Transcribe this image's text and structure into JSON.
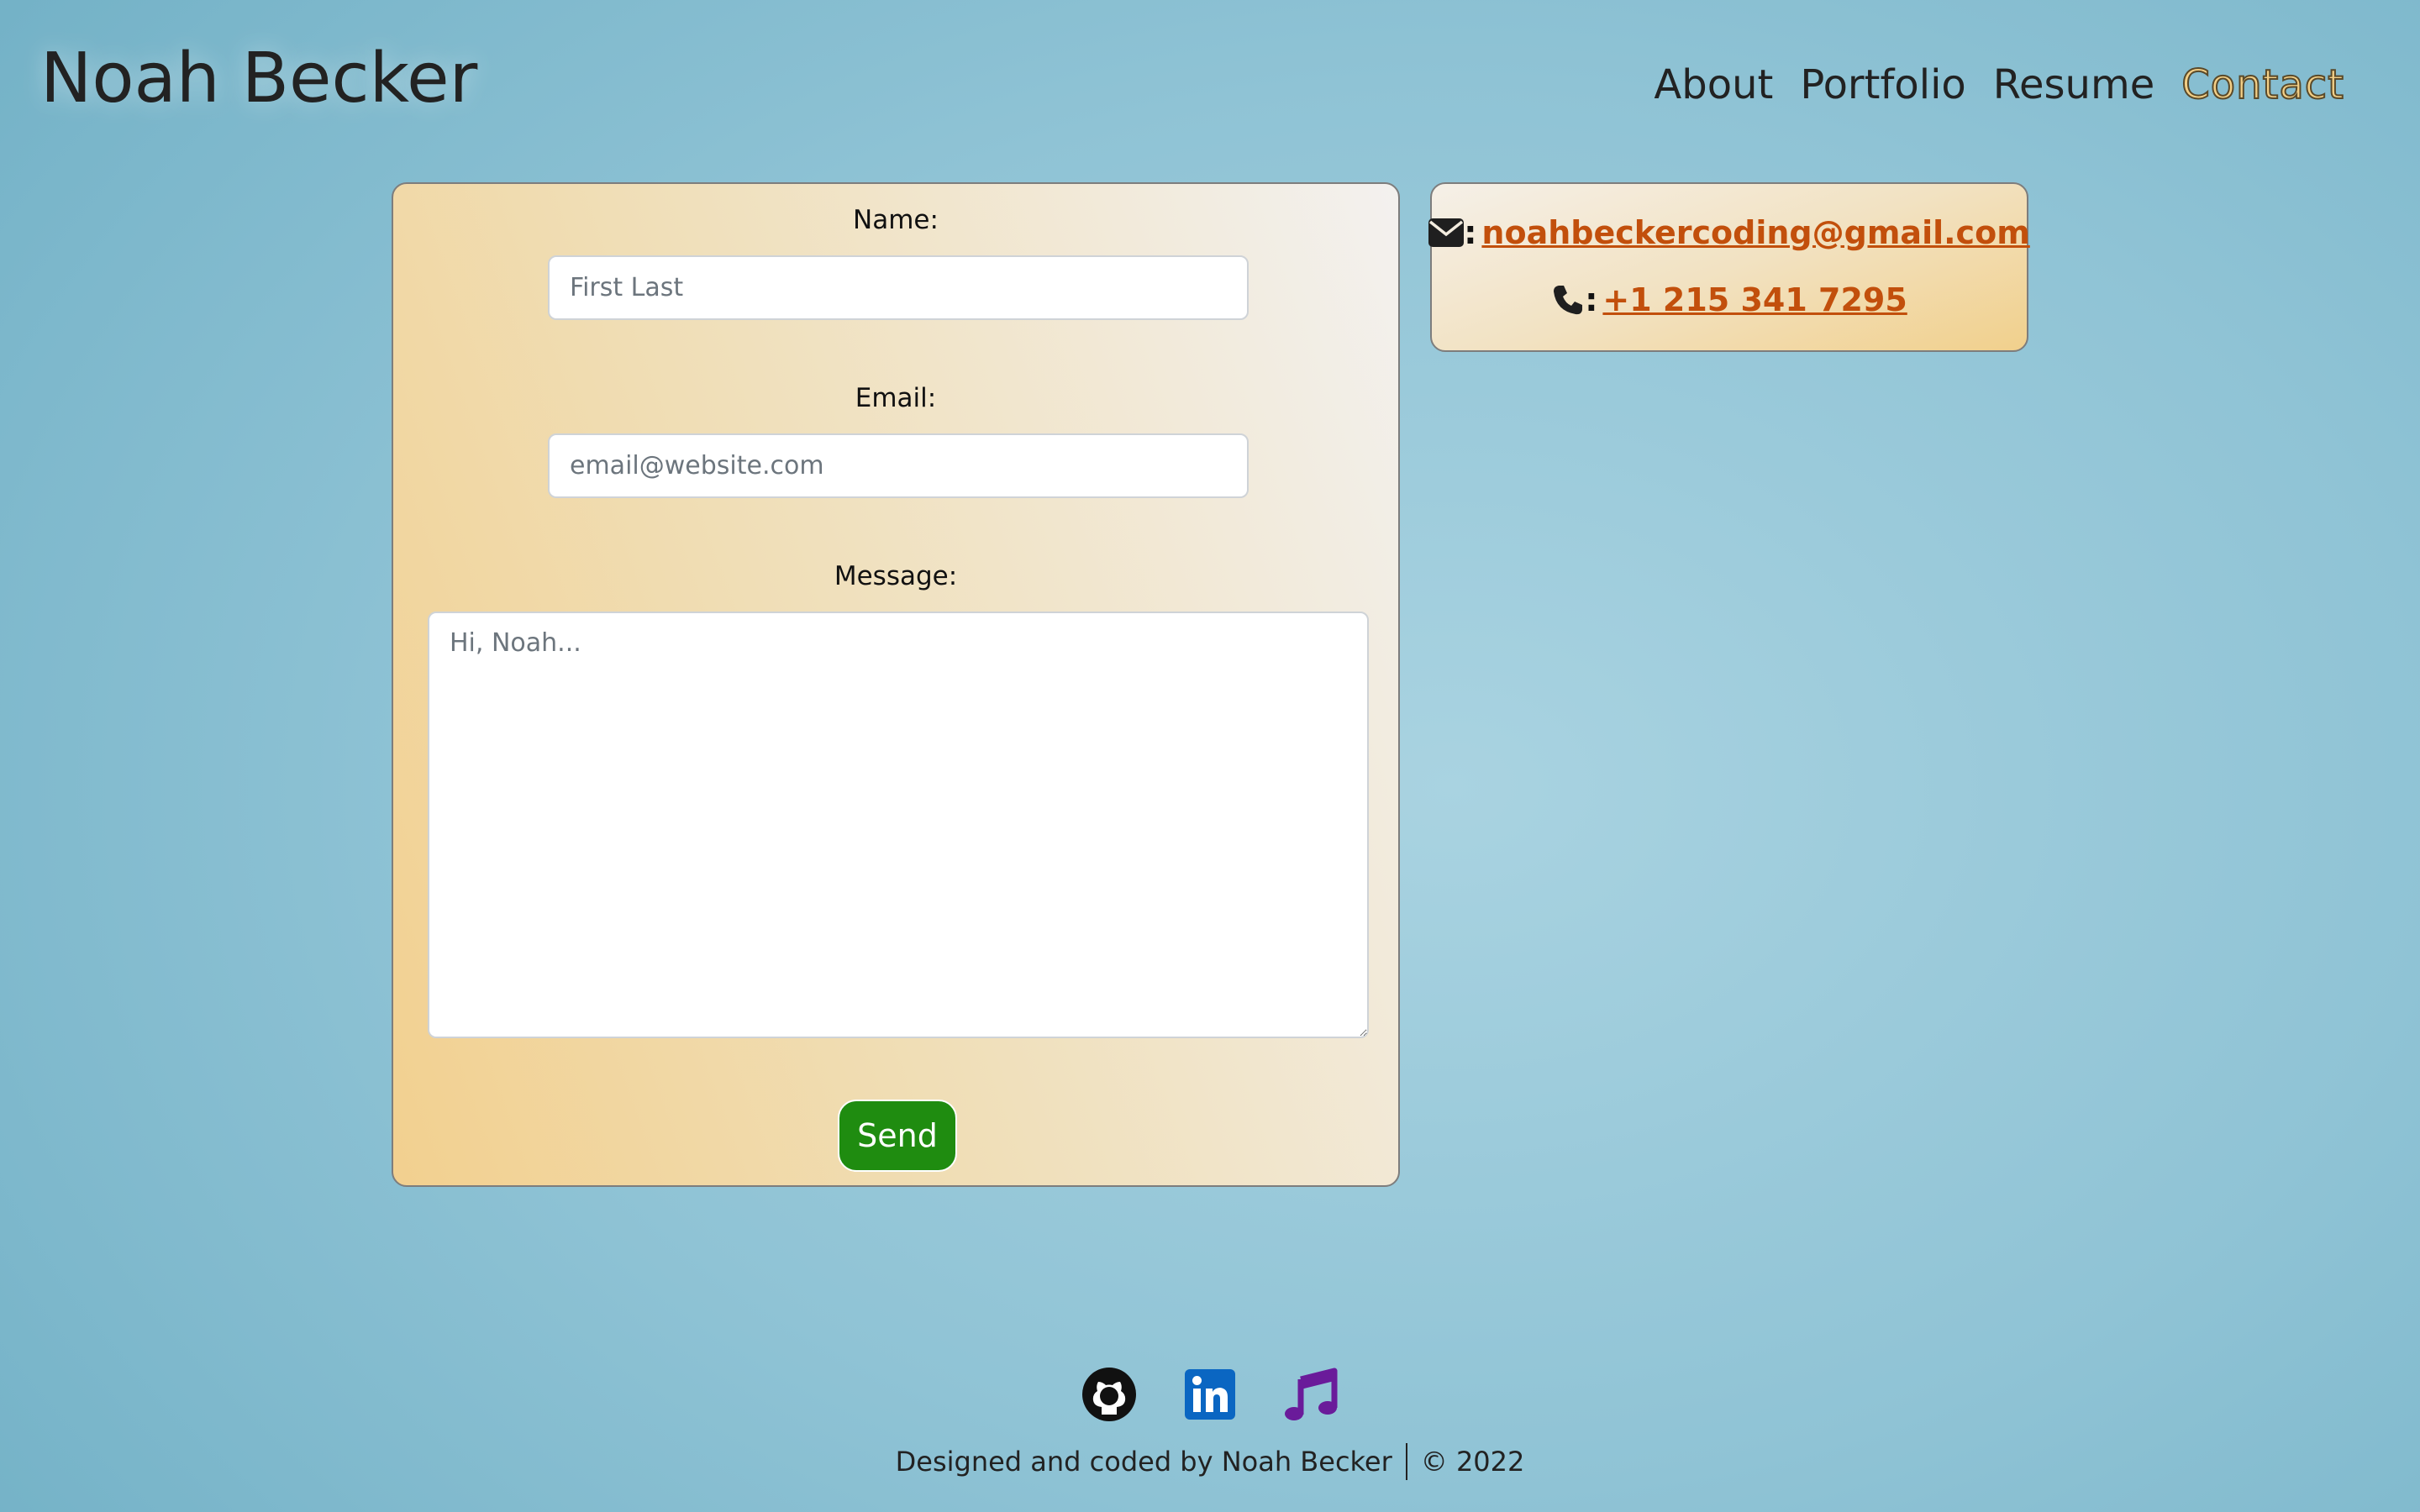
{
  "header": {
    "brand": "Noah Becker",
    "nav": [
      "About",
      "Portfolio",
      "Resume",
      "Contact"
    ],
    "active_nav": "Contact"
  },
  "form": {
    "name_label": "Name:",
    "name_placeholder": "First Last",
    "email_label": "Email:",
    "email_placeholder": "email@website.com",
    "message_label": "Message:",
    "message_placeholder": "Hi, Noah...",
    "send_label": "Send"
  },
  "contact": {
    "email_icon": "envelope-icon",
    "email": "noahbeckercoding@gmail.com",
    "phone_icon": "phone-icon",
    "phone": "+1 215 341 7295",
    "separator": ":"
  },
  "footer": {
    "social_icons": [
      "github-icon",
      "linkedin-icon",
      "music-note-icon"
    ],
    "credit": "Designed and coded by Noah Becker",
    "copyright": "© 2022"
  },
  "colors": {
    "link": "#c24f0c",
    "send_button": "#1f8c10",
    "linkedin": "#0a66c2",
    "music": "#6a1b9a",
    "active_nav": "#f3cf86"
  }
}
